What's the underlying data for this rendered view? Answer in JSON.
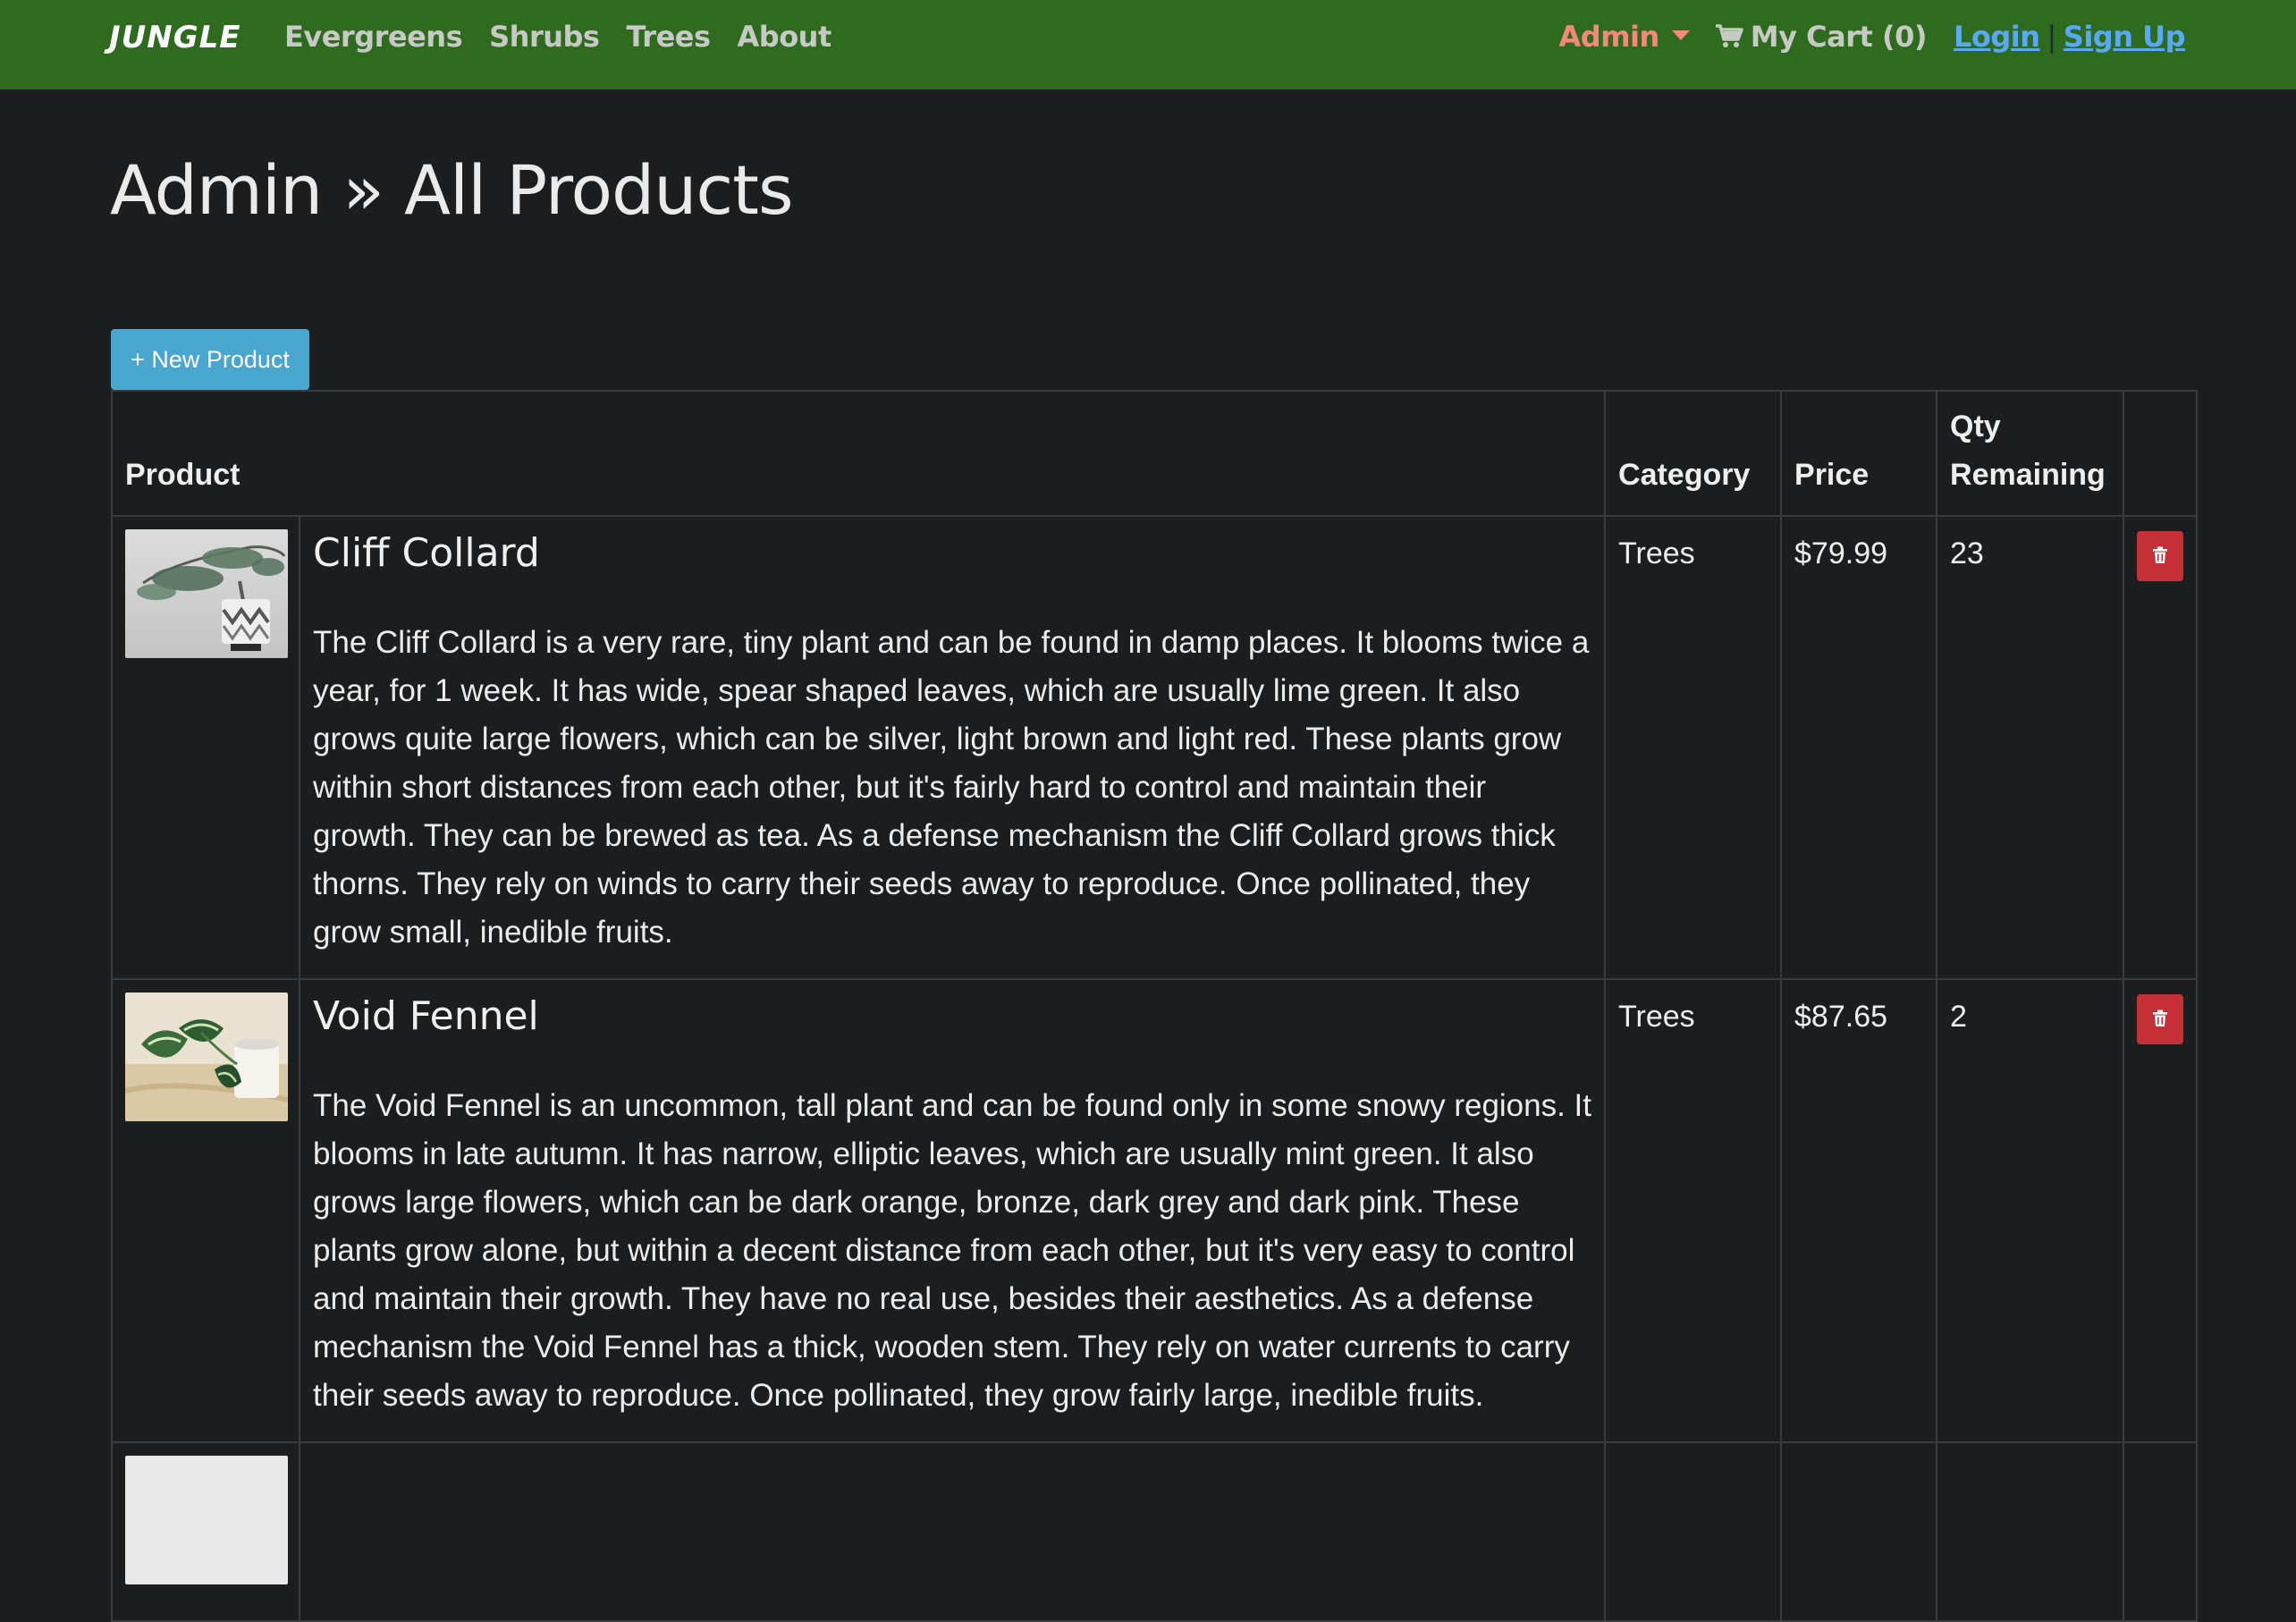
{
  "navbar": {
    "brand": "JUNGLE",
    "links": [
      "Evergreens",
      "Shrubs",
      "Trees",
      "About"
    ],
    "admin_label": "Admin",
    "cart_label": "My Cart (0)",
    "login_label": "Login",
    "separator": "|",
    "signup_label": "Sign Up",
    "colors": {
      "bar": "#2e6b1e",
      "admin": "#f4887a",
      "links": "#c6c9c4",
      "auth": "#58a9f5"
    }
  },
  "page": {
    "title": "Admin » All Products",
    "new_product_label": "+ New Product"
  },
  "table": {
    "headers": {
      "product": "Product",
      "category": "Category",
      "price": "Price",
      "qty": "Qty Remaining"
    },
    "rows": [
      {
        "name": "Cliff Collard",
        "description": "The Cliff Collard is a very rare, tiny plant and can be found in damp places. It blooms twice a year, for 1 week. It has wide, spear shaped leaves, which are usually lime green. It also grows quite large flowers, which can be silver, light brown and light red. These plants grow within short distances from each other, but it's fairly hard to control and maintain their growth. They can be brewed as tea. As a defense mechanism the Cliff Collard grows thick thorns. They rely on winds to carry their seeds away to reproduce. Once pollinated, they grow small, inedible fruits.",
        "category": "Trees",
        "price": "$79.99",
        "qty": "23",
        "image_icon": "bonsai-plant-photo"
      },
      {
        "name": "Void Fennel",
        "description": "The Void Fennel is an uncommon, tall plant and can be found only in some snowy regions. It blooms in late autumn. It has narrow, elliptic leaves, which are usually mint green. It also grows large flowers, which can be dark orange, bronze, dark grey and dark pink. These plants grow alone, but within a decent distance from each other, but it's very easy to control and maintain their growth. They have no real use, besides their aesthetics. As a defense mechanism the Void Fennel has a thick, wooden stem. They rely on water currents to carry their seeds away to reproduce. Once pollinated, they grow fairly large, inedible fruits.",
        "category": "Trees",
        "price": "$87.65",
        "qty": "2",
        "image_icon": "pothos-plant-photo"
      }
    ],
    "delete_icon": "trash-icon"
  }
}
